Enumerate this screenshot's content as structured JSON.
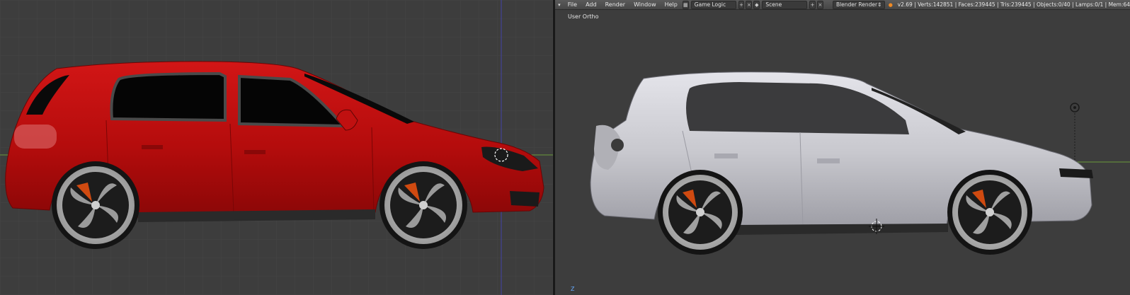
{
  "header": {
    "menu": [
      "File",
      "Add",
      "Render",
      "Window",
      "Help"
    ],
    "screen_layout": "Game Logic",
    "scene": "Scene",
    "render_engine": "Blender Render",
    "stats": "v2.69 | Verts:142851 | Faces:239445 | Tris:239445 | Objects:0/40 | Lamps:0/1 | Mem:64"
  },
  "viewport_right": {
    "view_label": "User Ortho",
    "axis_label": "Z"
  },
  "icons": [
    "blender-logo-icon",
    "menu-toggle-icon",
    "layout-icon",
    "scene-icon",
    "engine-dropdown-icon",
    "lamp-icon",
    "cursor-3d-icon"
  ],
  "colors": {
    "viewport_bg": "#3d3d3d",
    "grid_line": "#454545",
    "x_axis": "#6a9a3a",
    "y_axis": "#3a3a9a",
    "car_left_body": "#b80d0d",
    "car_right_body": "#c8c8cc",
    "header_bg": "#4d4d4d"
  }
}
